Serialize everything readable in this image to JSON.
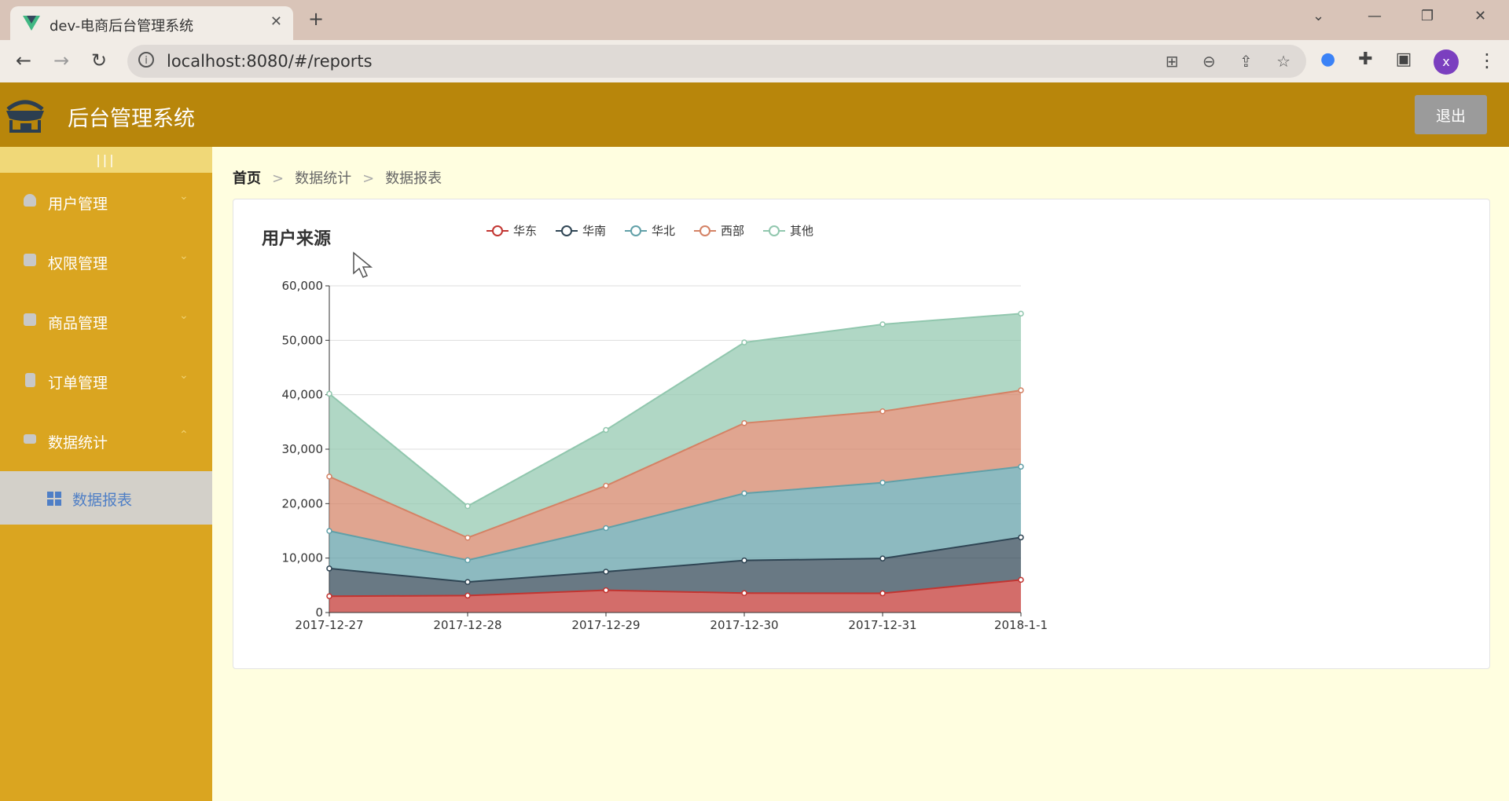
{
  "browser": {
    "tab_title": "dev-电商后台管理系统",
    "url": "localhost:8080/#/reports",
    "profile_letter": "x"
  },
  "app": {
    "title": "后台管理系统",
    "logout_label": "退出"
  },
  "sidebar": {
    "toggle_label": "|||",
    "items": [
      {
        "label": "用户管理",
        "icon": "user-icon"
      },
      {
        "label": "权限管理",
        "icon": "briefcase-icon"
      },
      {
        "label": "商品管理",
        "icon": "bag-icon"
      },
      {
        "label": "订单管理",
        "icon": "clipboard-icon"
      },
      {
        "label": "数据统计",
        "icon": "mail-icon"
      }
    ],
    "sub_items": [
      {
        "label": "数据报表",
        "icon": "grid-icon"
      }
    ]
  },
  "breadcrumb": [
    "首页",
    "数据统计",
    "数据报表"
  ],
  "chart_data": {
    "type": "area",
    "stacked": true,
    "title": "用户来源",
    "x": [
      "2017-12-27",
      "2017-12-28",
      "2017-12-29",
      "2017-12-30",
      "2017-12-31",
      "2018-1-1"
    ],
    "ylim": [
      0,
      60000
    ],
    "yticks": [
      0,
      10000,
      20000,
      30000,
      40000,
      50000,
      60000
    ],
    "ytick_labels": [
      "0",
      "10,000",
      "20,000",
      "30,000",
      "40,000",
      "50,000",
      "60,000"
    ],
    "grid": true,
    "legend_position": "top",
    "series": [
      {
        "name": "华东",
        "color": "#c23531",
        "values": [
          2999,
          3111,
          4100,
          3565,
          3528,
          6000
        ]
      },
      {
        "name": "华南",
        "color": "#2f4554",
        "values": [
          5090,
          2500,
          3400,
          6000,
          6400,
          7800
        ]
      },
      {
        "name": "华北",
        "color": "#61a0a8",
        "values": [
          6888,
          4000,
          8010,
          12321,
          13928,
          12984
        ]
      },
      {
        "name": "西部",
        "color": "#d48265",
        "values": [
          9991,
          4130,
          7777,
          12903,
          13098,
          14028
        ]
      },
      {
        "name": "其他",
        "color": "#91c7ae",
        "values": [
          15212,
          5800,
          10241,
          14821,
          15982,
          14091
        ]
      }
    ]
  }
}
